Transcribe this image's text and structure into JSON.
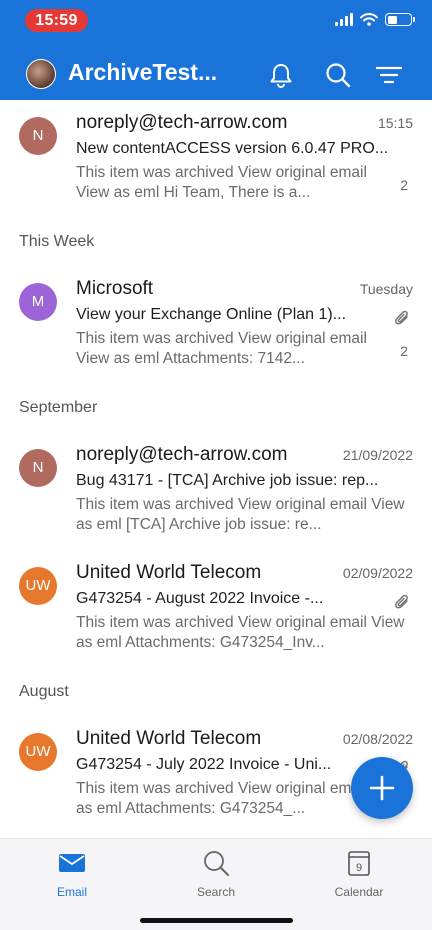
{
  "status_bar": {
    "time": "15:59"
  },
  "header": {
    "title": "ArchiveTest..."
  },
  "sections": {
    "this_week": "This Week",
    "september": "September",
    "august": "August"
  },
  "emails": [
    {
      "initials": "N",
      "avatar_color": "#b06a60",
      "sender": "noreply@tech-arrow.com",
      "date": "15:15",
      "subject": "New contentACCESS version 6.0.47 PRO...",
      "preview": "This item was archived View original email View as eml Hi Team, There is a...",
      "count": "2",
      "attachment": false
    },
    {
      "initials": "M",
      "avatar_color": "#9c64d6",
      "sender": "Microsoft",
      "date": "Tuesday",
      "subject": "View your Exchange Online (Plan 1)...",
      "preview": "This item was archived View original email View as eml Attachments: 7142...",
      "count": "2",
      "attachment": true
    },
    {
      "initials": "N",
      "avatar_color": "#b06a60",
      "sender": "noreply@tech-arrow.com",
      "date": "21/09/2022",
      "subject": "Bug 43171 - [TCA] Archive job issue: rep...",
      "preview": "This item was archived View original email View as eml [TCA] Archive job issue: re...",
      "count": "",
      "attachment": false
    },
    {
      "initials": "UW",
      "avatar_color": "#e8772e",
      "sender": "United World Telecom",
      "date": "02/09/2022",
      "subject": "G473254 - August 2022 Invoice -...",
      "preview": "This item was archived View original email View as eml Attachments: G473254_Inv...",
      "count": "",
      "attachment": true
    },
    {
      "initials": "UW",
      "avatar_color": "#e8772e",
      "sender": "United World Telecom",
      "date": "02/08/2022",
      "subject": "G473254 - July 2022 Invoice - Uni...",
      "preview": "This item was archived View original email View as eml Attachments: G473254_...",
      "count": "",
      "attachment": true
    }
  ],
  "tabs": {
    "email": "Email",
    "search": "Search",
    "calendar": "Calendar",
    "calendar_day": "9"
  },
  "colors": {
    "accent": "#1a73d9",
    "time_pill": "#e53935"
  },
  "icons": [
    "bell-icon",
    "search-icon",
    "filter-icon",
    "paperclip-icon",
    "plus-icon",
    "mail-icon",
    "calendar-icon"
  ]
}
